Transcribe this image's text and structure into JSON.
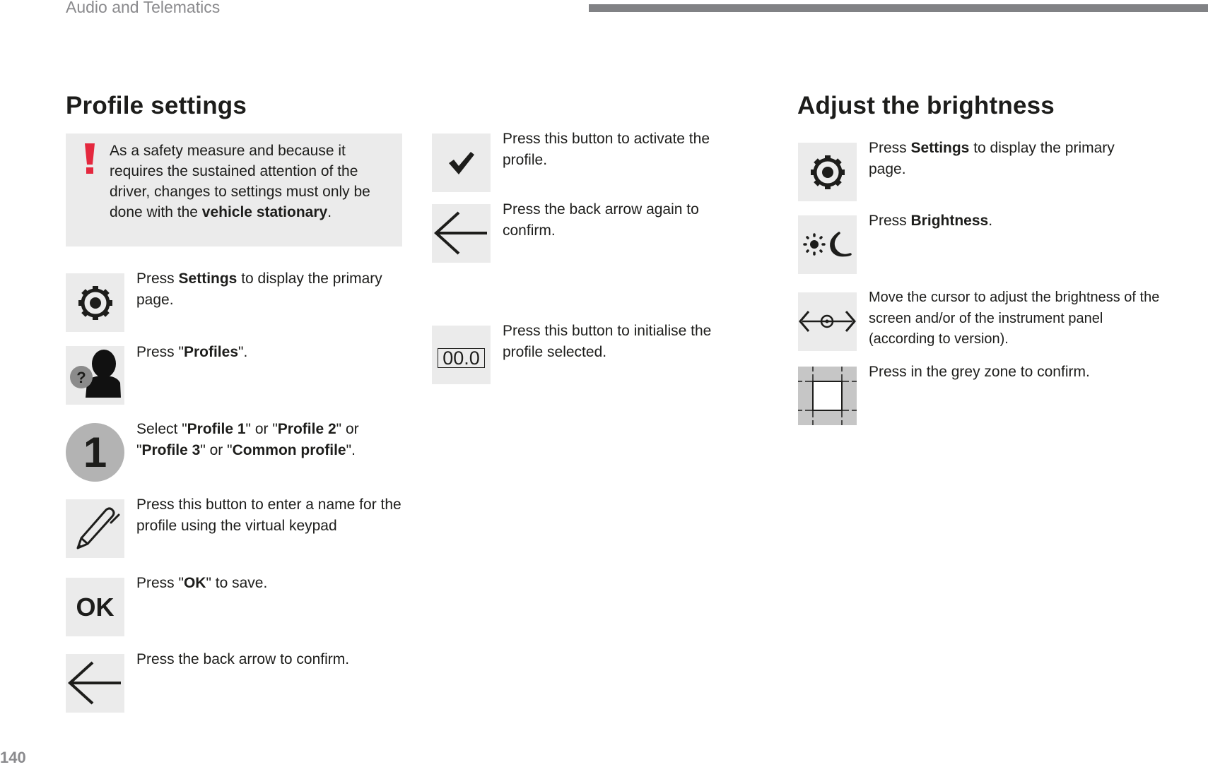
{
  "header": {
    "section_title": "Audio and Telematics"
  },
  "footer": {
    "page_number": "140"
  },
  "colors": {
    "warning_red": "#e4283e",
    "icon_bg": "#ebebeb",
    "header_bar": "#818285"
  },
  "profile_settings": {
    "title": "Profile settings",
    "warning": {
      "icon": "exclamation-icon",
      "text_before": "As a safety measure and because it requires the sustained attention of the driver, changes to settings must only be done with the ",
      "text_bold": "vehicle stationary",
      "text_after": "."
    },
    "steps": [
      {
        "icon": "settings-gear-icon",
        "pre": "Press ",
        "bold": "Settings",
        "post": " to display the primary page."
      },
      {
        "icon": "profiles-user-question-icon",
        "pre": "Press \"",
        "bold": "Profiles",
        "post": "\"."
      },
      {
        "icon": "number-one-icon",
        "icon_label": "1",
        "parts": [
          {
            "t": "Select \"",
            "b": false
          },
          {
            "t": "Profile 1",
            "b": true
          },
          {
            "t": "\" or \"",
            "b": false
          },
          {
            "t": "Profile 2",
            "b": true
          },
          {
            "t": "\" or \"",
            "b": false
          },
          {
            "t": "Profile 3",
            "b": true
          },
          {
            "t": "\" or \"",
            "b": false
          },
          {
            "t": "Common profile",
            "b": true
          },
          {
            "t": "\".",
            "b": false
          }
        ]
      },
      {
        "icon": "pencil-icon",
        "text": "Press this button to enter a name for the profile using the virtual keypad"
      },
      {
        "icon": "ok-icon",
        "icon_label": "OK",
        "pre": "Press \"",
        "bold": "OK",
        "post": "\" to save."
      },
      {
        "icon": "back-arrow-icon",
        "text": "Press the back arrow to confirm."
      },
      {
        "icon": "checkmark-icon",
        "text": "Press this button to activate the profile."
      },
      {
        "icon": "back-arrow-icon",
        "text": "Press the back arrow again to confirm."
      },
      {
        "icon": "reset-counter-icon",
        "icon_label": "00.0",
        "text": "Press this button to initialise the profile selected."
      }
    ]
  },
  "brightness": {
    "title": "Adjust the brightness",
    "steps": [
      {
        "icon": "settings-gear-icon",
        "pre": "Press ",
        "bold": "Settings",
        "post": " to display the primary page."
      },
      {
        "icon": "brightness-sun-moon-icon",
        "pre": "Press ",
        "bold": "Brightness",
        "post": "."
      },
      {
        "icon": "slider-cursor-icon",
        "text": "Move the cursor to adjust the brightness of the screen and/or of the instrument panel (according to version)."
      },
      {
        "icon": "grey-zone-icon",
        "text": "Press in the grey zone to confirm."
      }
    ]
  }
}
